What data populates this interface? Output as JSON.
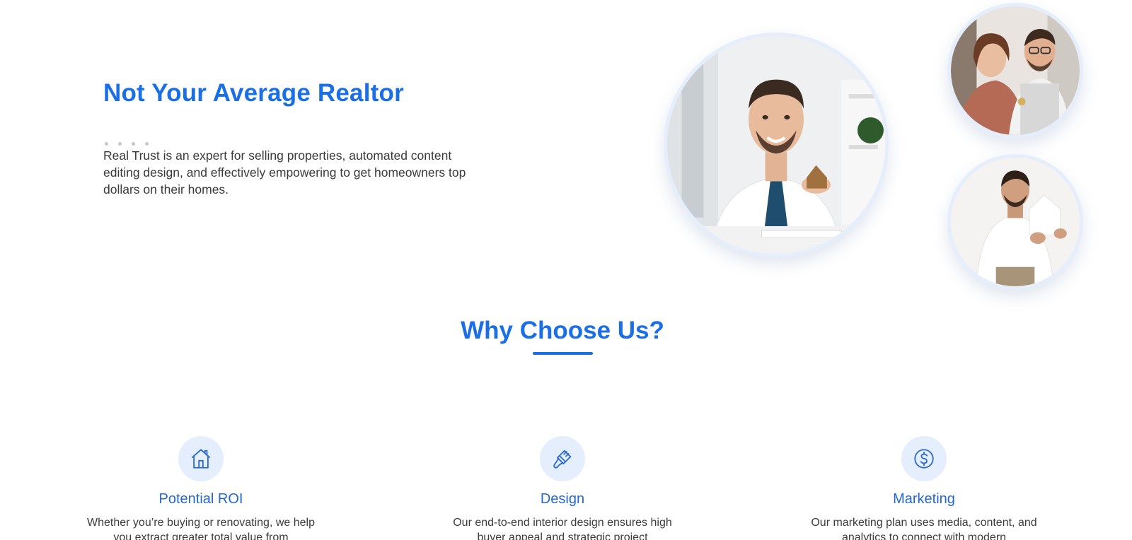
{
  "hero": {
    "title": "Not Your Average Realtor",
    "description": "Real Trust is an expert for selling properties, automated content editing design, and effectively empowering to get homeowners top dollars on their homes."
  },
  "why": {
    "title": "Why Choose Us?"
  },
  "features": [
    {
      "icon": "house-icon",
      "title": "Potential ROI",
      "text": "Whether you’re buying or renovating, we help you extract greater total value from"
    },
    {
      "icon": "paintbrush-icon",
      "title": "Design",
      "text": "Our end-to-end interior design ensures high buyer appeal and strategic project"
    },
    {
      "icon": "dollar-icon",
      "title": "Marketing",
      "text": "Our marketing plan uses media, content, and analytics to connect with modern"
    }
  ],
  "colors": {
    "accent": "#1a6fe6",
    "icon_bg": "#e5eefc",
    "circle_border": "#e7eefb"
  }
}
